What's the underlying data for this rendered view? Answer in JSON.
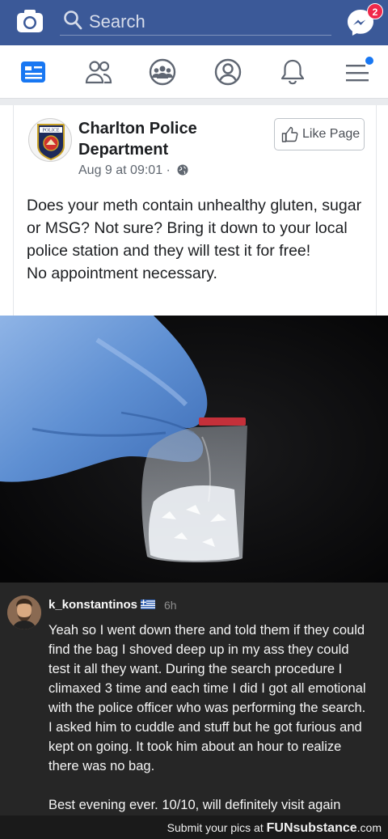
{
  "topbar": {
    "search_placeholder": "Search",
    "messenger_badge": "2",
    "bg_color": "#3b5998"
  },
  "nav": {
    "icons": [
      "news-feed-icon",
      "friends-icon",
      "groups-icon",
      "profile-icon",
      "notifications-icon",
      "menu-icon"
    ]
  },
  "post": {
    "page_name": "Charlton Police Department",
    "date": "Aug 9 at 09:01 ·",
    "like_label": "Like Page",
    "text_line1": "Does your meth contain unhealthy gluten, sugar or MSG? Not sure? Bring it down to your local police station and they will test it for free!",
    "text_line2": "No appointment necessary.",
    "avatar_text": "POLICE"
  },
  "comment": {
    "username": "k_konstantinos",
    "time": "6h",
    "para1": "Yeah so I went down there and told them if they could find the bag I shoved deep up in my ass they could test it all they want. During the search procedure I climaxed 3 time and each time I did I got all emotional with the police officer who was performing the search. I asked him to cuddle and stuff but he got furious and kept on going. It took him about an hour to realize there was no bag.",
    "para2": "Best evening ever. 10/10, will definitely visit again"
  },
  "footer": {
    "prefix": "Submit your pics at",
    "brand": "FUNsubstance",
    "suffix": ".com"
  }
}
